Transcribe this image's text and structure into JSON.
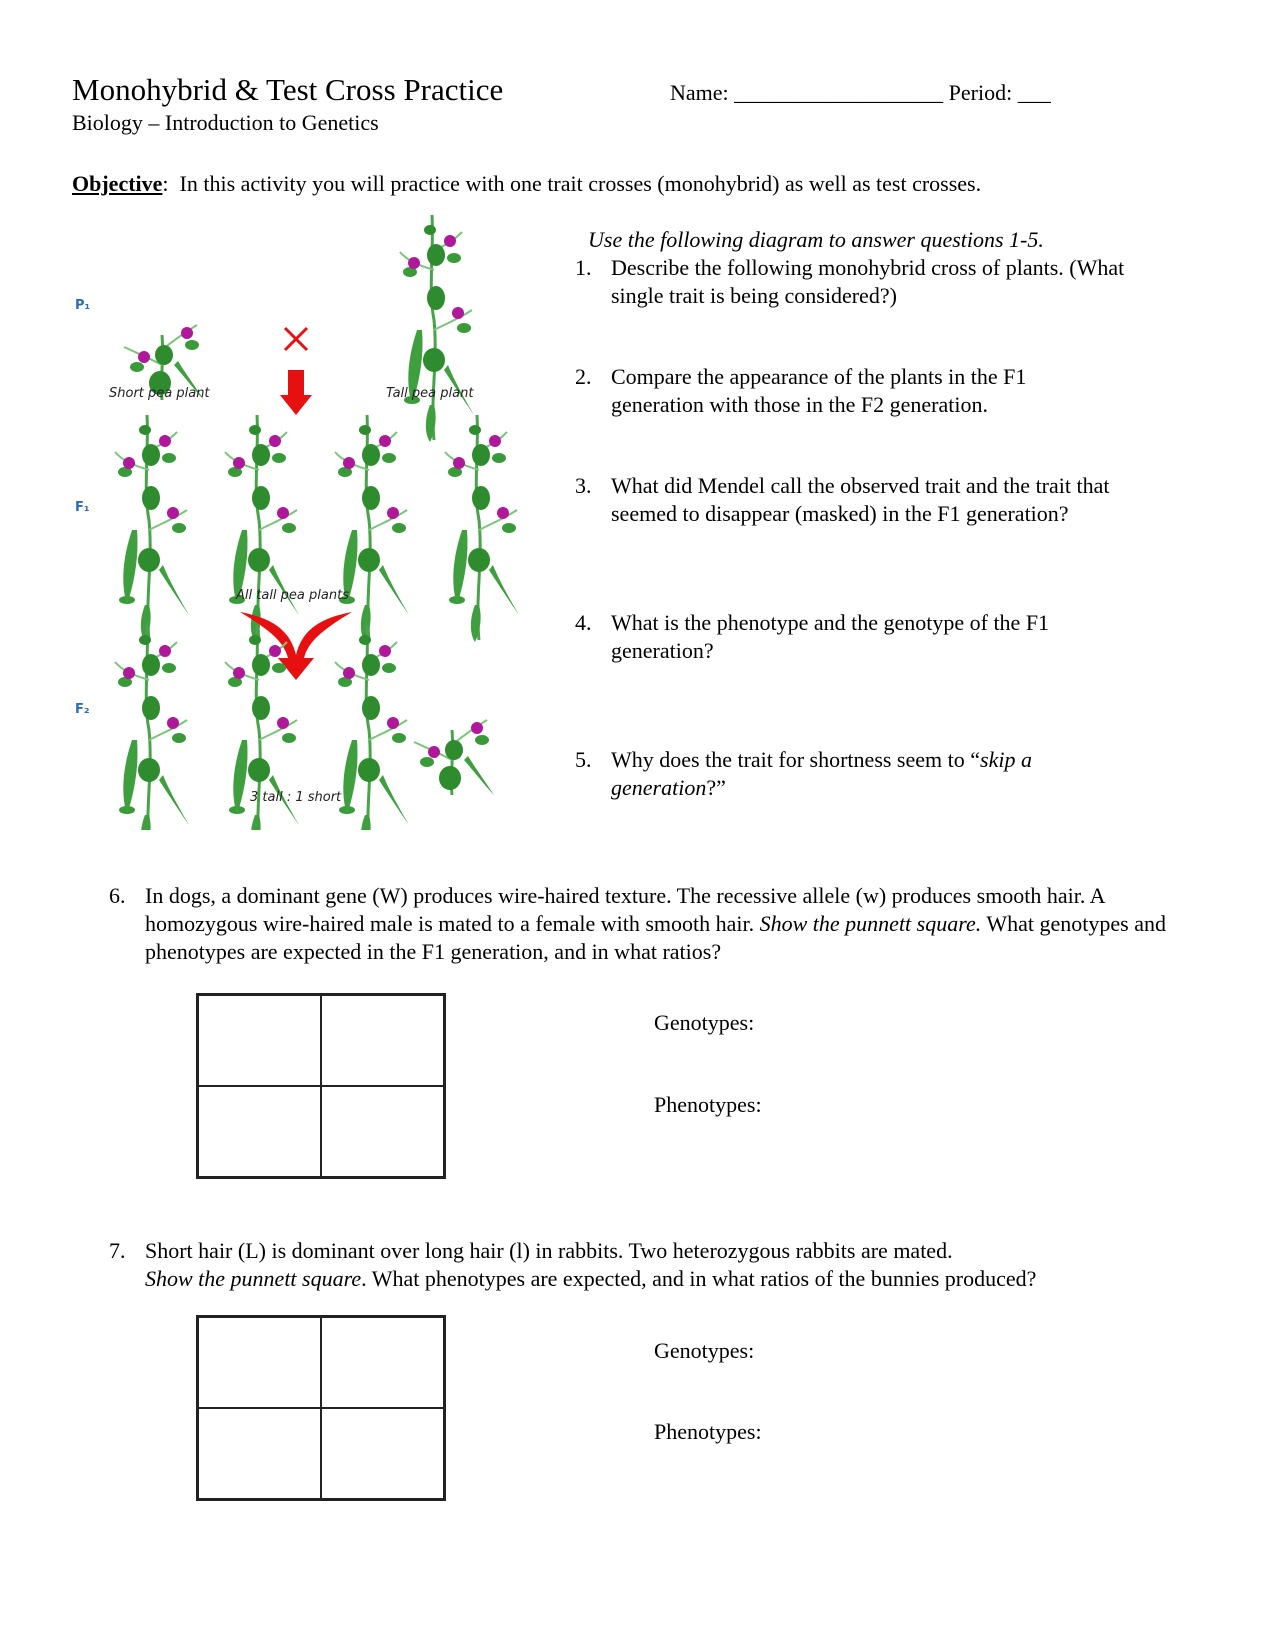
{
  "header": {
    "title": "Monohybrid & Test Cross Practice",
    "subtitle": "Biology – Introduction to Genetics",
    "name_label": "Name:",
    "name_blank": "___________________",
    "period_label": "Period:",
    "period_blank": "___"
  },
  "objective": {
    "label": "Objective",
    "text": ":  In this activity you will practice with one trait crosses (monohybrid) as well as test crosses."
  },
  "diagram": {
    "generations": [
      "P₁",
      "F₁",
      "F₂"
    ],
    "labels": {
      "short_plant": "Short pea plant",
      "tall_plant": "Tall pea plant",
      "f1_caption": "All tall pea plants",
      "f2_caption": "3 tall : 1 short"
    },
    "cross_symbol": "✕",
    "colors": {
      "stem": "#2e8b2e",
      "leaf": "#3a9a3a",
      "flower": "#b0189a",
      "arrow": "#e61010",
      "gen_label": "#2b6cb8"
    }
  },
  "questions_intro": "Use the following diagram to answer questions 1-5.",
  "questions": [
    {
      "num": "1.",
      "text": "Describe the following monohybrid cross of plants. (What single trait is being considered?)"
    },
    {
      "num": "2.",
      "text": "Compare the appearance of the plants in the F1 generation with those in the F2 generation."
    },
    {
      "num": "3.",
      "text": "What did Mendel call the observed trait and the trait that seemed to disappear (masked) in the F1 generation?"
    },
    {
      "num": "4.",
      "text": "What is the phenotype and the genotype of the F1 generation?"
    },
    {
      "num": "5.",
      "text_before": "Why does the trait for shortness seem to “",
      "text_italic": "skip a generation",
      "text_after": "?”"
    }
  ],
  "problem6": {
    "num": "6.",
    "text_a": "In dogs, a dominant gene (W) produces wire-haired texture.  The recessive allele (w) produces smooth hair.  A homozygous wire-haired male is mated to a female with smooth hair.  ",
    "text_italic": "Show the punnett square.",
    "text_b": " What genotypes and phenotypes are expected in the F1 generation, and in what ratios?",
    "genotypes_label": "Genotypes:",
    "phenotypes_label": "Phenotypes:"
  },
  "problem7": {
    "num": "7.",
    "text_a": "Short hair (L) is dominant over long hair (l) in rabbits.  Two heterozygous rabbits are mated.",
    "text_italic": "Show the punnett square",
    "text_b": ". What phenotypes are expected, and in what ratios of the bunnies produced?",
    "genotypes_label": "Genotypes:",
    "phenotypes_label": "Phenotypes:"
  }
}
